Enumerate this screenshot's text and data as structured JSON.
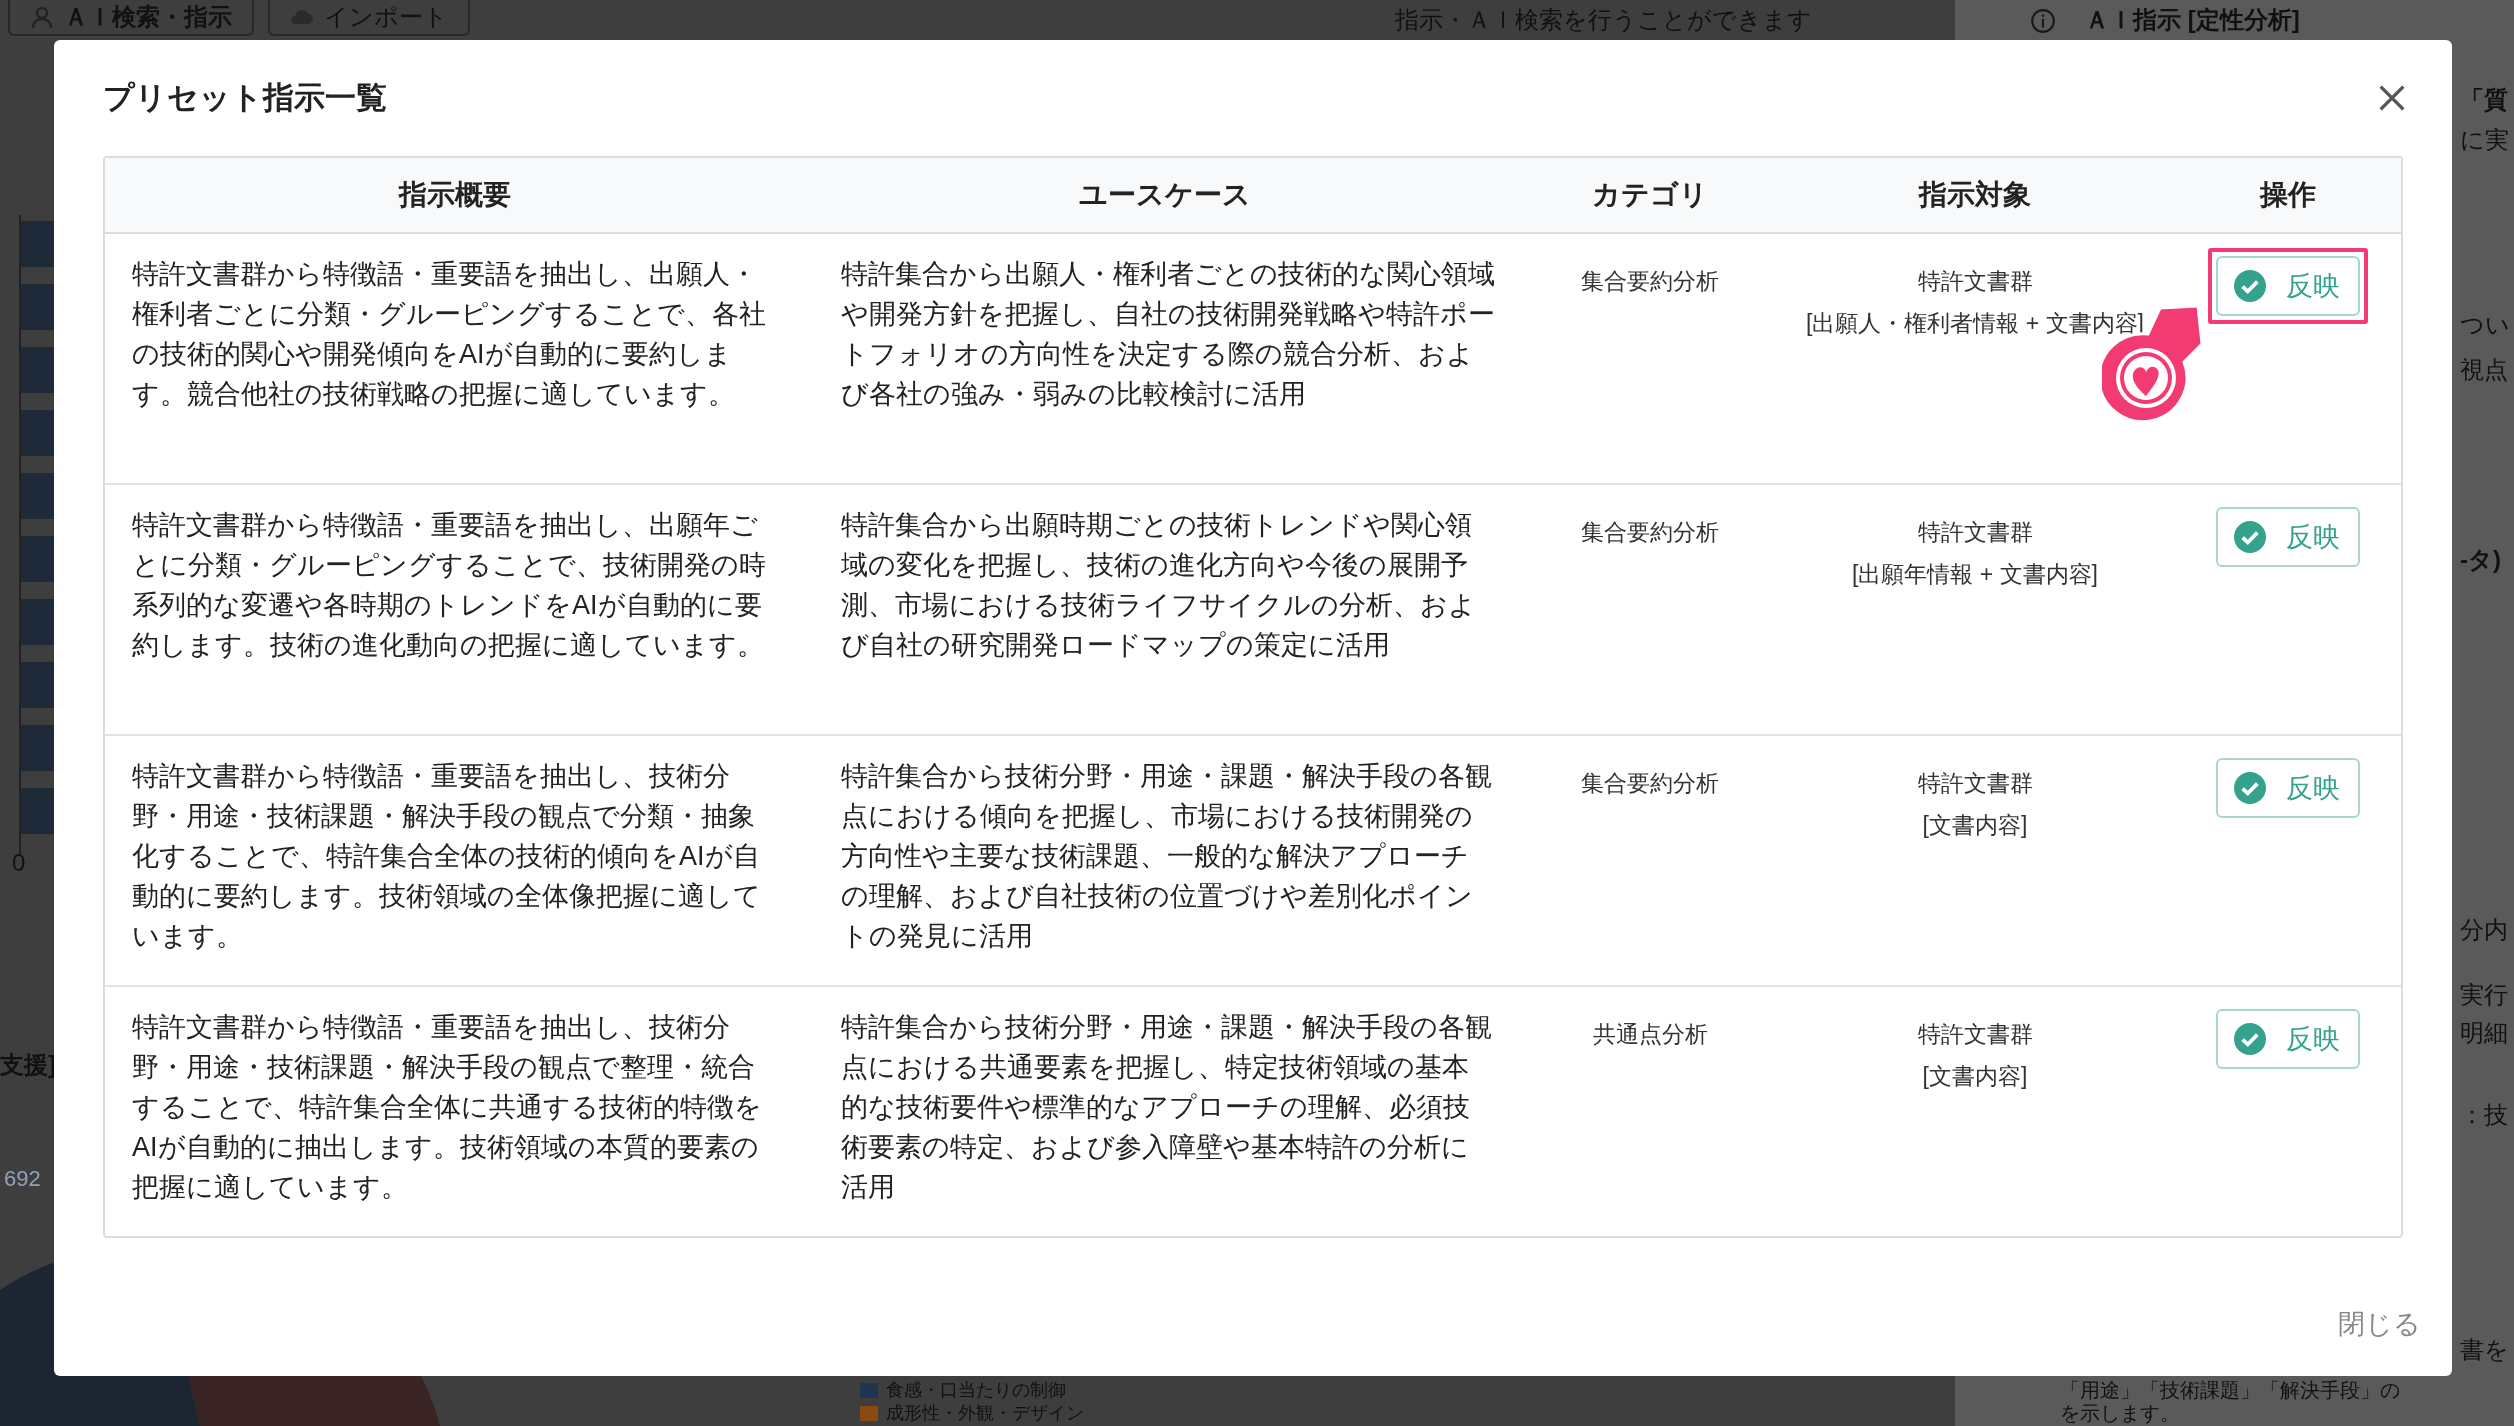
{
  "background": {
    "tabs": [
      "ＡＩ検索・指示",
      "インポート"
    ],
    "top_note": "指示・ＡＩ検索を行うことができます",
    "panel_title": "ＡＩ指示 [定性分析]",
    "right_fragments": [
      {
        "text": "「質",
        "bold": true
      },
      {
        "text": "に実",
        "bold": false
      },
      {
        "text": "つい",
        "bold": false
      },
      {
        "text": "視点",
        "bold": false
      },
      {
        "text": "-タ)",
        "bold": true
      },
      {
        "text": "分内",
        "bold": false
      },
      {
        "text": "実行",
        "bold": false
      },
      {
        "text": "明細",
        "bold": false
      },
      {
        "text": "：技",
        "bold": false
      },
      {
        "text": "書を",
        "bold": false
      }
    ],
    "axis_zero": "0",
    "left_heading": "支援]",
    "left_number": "692",
    "legend": [
      {
        "label": "食感・口当たりの制御",
        "color": "#1f3550"
      },
      {
        "label": "成形性・外観・デザイン",
        "color": "#8a4a12"
      }
    ],
    "bottom_notes": [
      "「用途」「技術課題」「解決手段」の",
      "を示します。"
    ]
  },
  "modal": {
    "title": "プリセット指示一覧",
    "close": "閉じる",
    "columns": [
      "指示概要",
      "ユースケース",
      "カテゴリ",
      "指示対象",
      "操作"
    ],
    "rows": [
      {
        "summary": "特許文書群から特徴語・重要語を抽出し、出願人・権利者ごとに分類・グルーピングすることで、各社の技術的関心や開発傾向をAIが自動的に要約します。競合他社の技術戦略の把握に適しています。",
        "use_case": "特許集合から出願人・権利者ごとの技術的な関心領域や開発方針を把握し、自社の技術開発戦略や特許ポートフォリオの方向性を決定する際の競合分析、および各社の強み・弱みの比較検討に活用",
        "category": "集合要約分析",
        "target": [
          "特許文書群",
          "[出願人・権利者情報 + 文書内容]"
        ],
        "action": "反映",
        "highlighted": true
      },
      {
        "summary": "特許文書群から特徴語・重要語を抽出し、出願年ごとに分類・グルーピングすることで、技術開発の時系列的な変遷や各時期のトレンドをAIが自動的に要約します。技術の進化動向の把握に適しています。",
        "use_case": "特許集合から出願時期ごとの技術トレンドや関心領域の変化を把握し、技術の進化方向や今後の展開予測、市場における技術ライフサイクルの分析、および自社の研究開発ロードマップの策定に活用",
        "category": "集合要約分析",
        "target": [
          "特許文書群",
          "[出願年情報 + 文書内容]"
        ],
        "action": "反映",
        "highlighted": false
      },
      {
        "summary": "特許文書群から特徴語・重要語を抽出し、技術分野・用途・技術課題・解決手段の観点で分類・抽象化することで、特許集合全体の技術的傾向をAIが自動的に要約します。技術領域の全体像把握に適しています。",
        "use_case": "特許集合から技術分野・用途・課題・解決手段の各観点における傾向を把握し、市場における技術開発の方向性や主要な技術課題、一般的な解決アプローチの理解、および自社技術の位置づけや差別化ポイントの発見に活用",
        "category": "集合要約分析",
        "target": [
          "特許文書群",
          "[文書内容]"
        ],
        "action": "反映",
        "highlighted": false
      },
      {
        "summary": "特許文書群から特徴語・重要語を抽出し、技術分野・用途・技術課題・解決手段の観点で整理・統合することで、特許集合全体に共通する技術的特徴をAIが自動的に抽出します。技術領域の本質的要素の把握に適しています。",
        "use_case": "特許集合から技術分野・用途・課題・解決手段の各観点における共通要素を把握し、特定技術領域の基本的な技術要件や標準的なアプローチの理解、必須技術要素の特定、および参入障壁や基本特許の分析に活用",
        "category": "共通点分析",
        "target": [
          "特許文書群",
          "[文書内容]"
        ],
        "action": "反映",
        "highlighted": false
      }
    ]
  }
}
